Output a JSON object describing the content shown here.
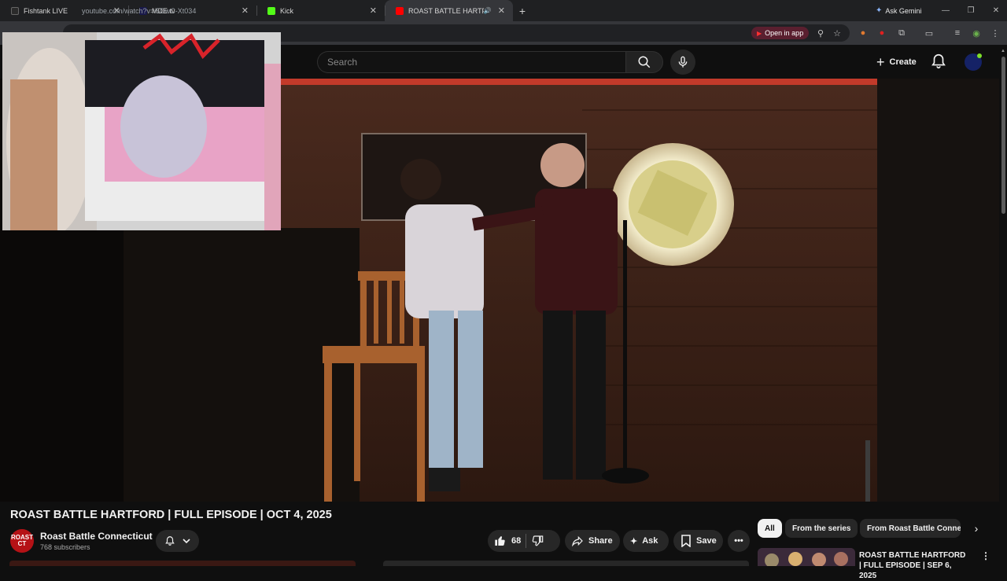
{
  "browser": {
    "tabs": [
      {
        "title": "Fishtank LIVE",
        "favicon_color": "#2b2b2b",
        "active": false
      },
      {
        "title": "MDE.tv",
        "favicon_color": "#1a1a4a",
        "active": false
      },
      {
        "title": "Kick",
        "favicon_color": "#53fc18",
        "active": false
      },
      {
        "title": "ROAST BATTLE HARTFORD",
        "favicon_color": "#ff0000",
        "active": true
      }
    ],
    "new_tab_label": "+",
    "ask_gemini_label": "Ask Gemini",
    "url": "youtube.com/watch?v=i5DwC-Xt034",
    "open_in_app_label": "Open in app"
  },
  "youtube": {
    "search_placeholder": "Search",
    "create_label": "Create"
  },
  "video": {
    "title": "ROAST BATTLE HARTFORD | FULL EPISODE | OCT 4, 2025",
    "channel_name": "Roast Battle Connecticut",
    "channel_avatar_text": "ROAST CT",
    "subscribers": "768 subscribers",
    "likes": "68",
    "share_label": "Share",
    "ask_label": "Ask",
    "save_label": "Save"
  },
  "chips": [
    "All",
    "From the series",
    "From Roast Battle Connecticut"
  ],
  "recommendation": {
    "title": "ROAST BATTLE HARTFORD | FULL EPISODE | SEP 6, 2025"
  },
  "colors": {
    "accent_red": "#ff0000",
    "background": "#0f0f0f",
    "chip_bg": "#272727"
  }
}
